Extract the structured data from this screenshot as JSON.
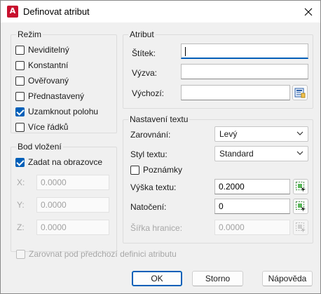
{
  "window": {
    "title": "Definovat atribut",
    "app_icon_letter": "A"
  },
  "rezim": {
    "legend": "Režim",
    "options": [
      {
        "label": "Neviditelný",
        "checked": false
      },
      {
        "label": "Konstantní",
        "checked": false
      },
      {
        "label": "Ověřovaný",
        "checked": false
      },
      {
        "label": "Přednastavený",
        "checked": false
      },
      {
        "label": "Uzamknout polohu",
        "checked": true
      },
      {
        "label": "Více řádků",
        "checked": false
      }
    ]
  },
  "bod": {
    "legend": "Bod vložení",
    "specify_on_screen": {
      "label": "Zadat na obrazovce",
      "checked": true
    },
    "x": {
      "label": "X:",
      "value": "0.0000"
    },
    "y": {
      "label": "Y:",
      "value": "0.0000"
    },
    "z": {
      "label": "Z:",
      "value": "0.0000"
    }
  },
  "atribut": {
    "legend": "Atribut",
    "stitek": {
      "label": "Štítek:",
      "value": ""
    },
    "vyzva": {
      "label": "Výzva:",
      "value": ""
    },
    "vychozi": {
      "label": "Výchozí:",
      "value": "",
      "button_icon": "insert-field-icon"
    }
  },
  "text_settings": {
    "legend": "Nastavení textu",
    "zarovnani": {
      "label": "Zarovnání:",
      "value": "Levý"
    },
    "styl": {
      "label": "Styl textu:",
      "value": "Standard"
    },
    "poznamky": {
      "label": "Poznámky",
      "checked": false
    },
    "vyska": {
      "label": "Výška textu:",
      "value": "0.2000"
    },
    "natoceni": {
      "label": "Natočení:",
      "value": "0"
    },
    "sirka": {
      "label": "Šířka hranice:",
      "value": "0.0000"
    }
  },
  "align_below": {
    "label": "Zarovnat pod předchozí definici atributu",
    "checked": false
  },
  "buttons": {
    "ok": "OK",
    "cancel": "Storno",
    "help": "Nápověda"
  },
  "colors": {
    "accent": "#005fb8",
    "app_icon": "#c8102e"
  }
}
